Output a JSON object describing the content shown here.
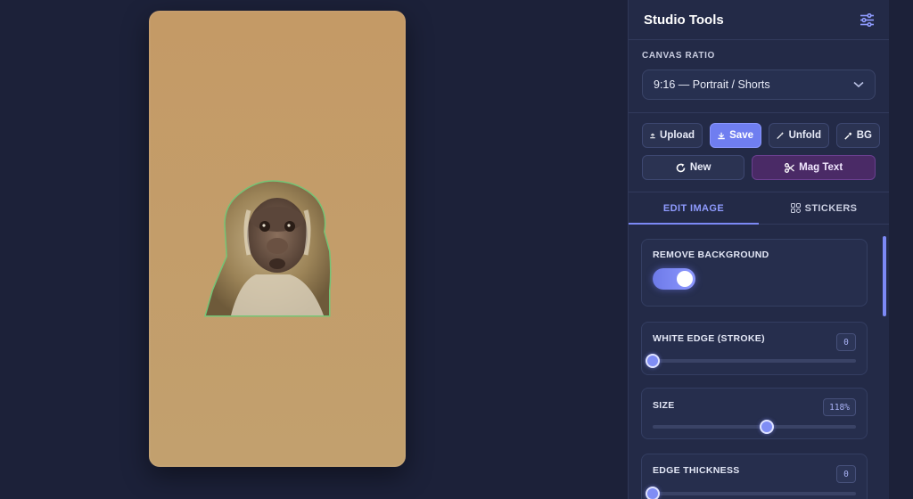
{
  "canvas": {
    "background": "#c49a66",
    "sticker": {
      "subject": "monkey-cutout",
      "outline_glow": "#59d17a"
    }
  },
  "panel": {
    "title": "Studio Tools",
    "settings_icon": "sliders-icon"
  },
  "canvas_ratio": {
    "label": "CANVAS RATIO",
    "selected": "9:16 — Portrait / Shorts"
  },
  "toolbar": {
    "upload": "Upload",
    "save": "Save",
    "unfold": "Unfold",
    "bg": "BG",
    "new": "New",
    "mag_text": "Mag Text"
  },
  "tabs": [
    {
      "label": "EDIT IMAGE",
      "active": true
    },
    {
      "label": "STICKERS",
      "active": false
    }
  ],
  "controls": {
    "remove_background": {
      "label": "REMOVE BACKGROUND",
      "enabled": true
    },
    "white_edge": {
      "label": "WHITE EDGE (STROKE)",
      "value": "0",
      "fraction": 0.0
    },
    "size": {
      "label": "SIZE",
      "value": "118%",
      "fraction": 0.56
    },
    "edge_thickness": {
      "label": "EDGE THICKNESS",
      "value": "0",
      "fraction": 0.0
    }
  },
  "colors": {
    "accent": "#7c89f5",
    "panel": "#232a47",
    "background": "#1c2139",
    "magic": "#4a2a66"
  }
}
